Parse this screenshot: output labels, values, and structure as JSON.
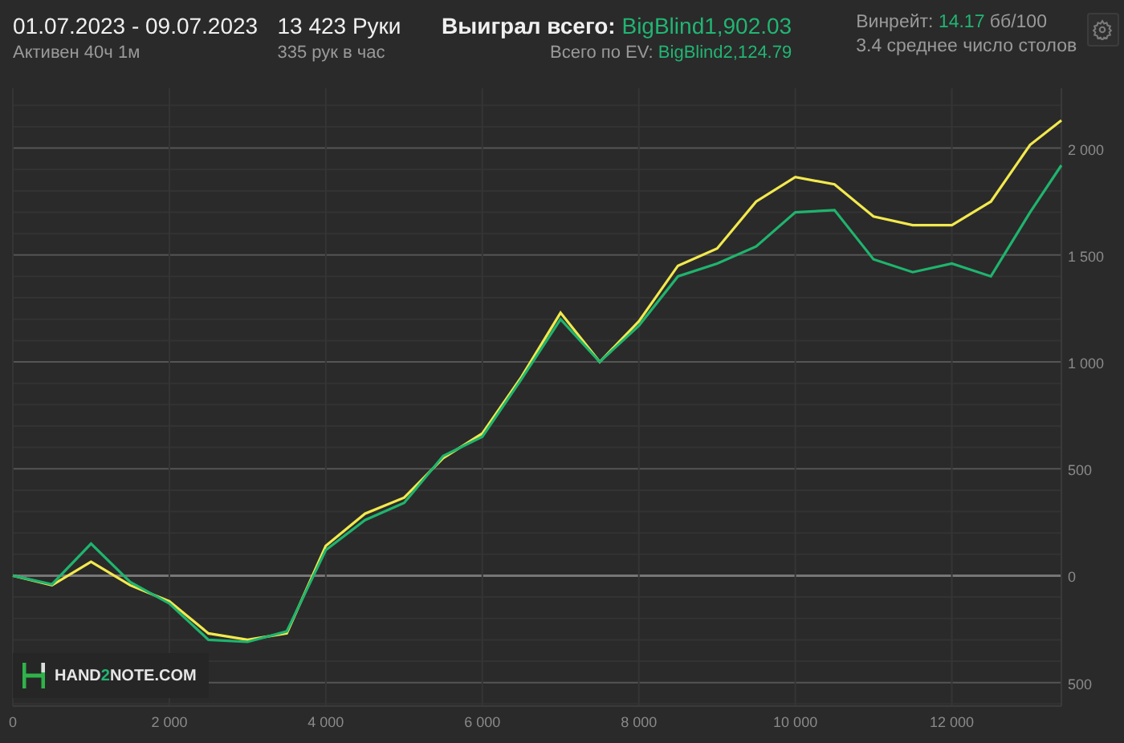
{
  "header": {
    "period": "01.07.2023 - 09.07.2023",
    "active": "Активен 40ч 1м",
    "hands": "13 423 Руки",
    "hands_rate": "335 рук в час",
    "won_label": "Выиграл всего:",
    "won_value": "BigBlind1,902.03",
    "ev_label": "Всего по EV:",
    "ev_value": "BigBlind2,124.79",
    "winrate_label": "Винрейт:",
    "winrate_value": "14.17",
    "winrate_unit": "бб/100",
    "tables": "3.4 среднее число столов"
  },
  "logo": {
    "before": "HAND",
    "accent": "2",
    "after": "NOTE.COM"
  },
  "chart_data": {
    "type": "line",
    "grid": true,
    "xlim": [
      0,
      13400
    ],
    "ylim": [
      -610,
      2280
    ],
    "xticks": [
      {
        "value": 0,
        "label": "0"
      },
      {
        "value": 2000,
        "label": "2 000"
      },
      {
        "value": 4000,
        "label": "4 000"
      },
      {
        "value": 6000,
        "label": "6 000"
      },
      {
        "value": 8000,
        "label": "8 000"
      },
      {
        "value": 10000,
        "label": "10 000"
      },
      {
        "value": 12000,
        "label": "12 000"
      }
    ],
    "yticks": [
      {
        "value": 2000,
        "label": "2 000"
      },
      {
        "value": 1500,
        "label": "1 500"
      },
      {
        "value": 1000,
        "label": "1 000"
      },
      {
        "value": 500,
        "label": "500"
      },
      {
        "value": 0,
        "label": "0"
      },
      {
        "value": -500,
        "label": "500"
      }
    ],
    "x": [
      0,
      500,
      1000,
      1500,
      2000,
      2500,
      3000,
      3500,
      4000,
      4500,
      5000,
      5500,
      6000,
      6500,
      7000,
      7500,
      8000,
      8500,
      9000,
      9500,
      10000,
      10500,
      11000,
      11500,
      12000,
      12500,
      13000,
      13400
    ],
    "series": [
      {
        "color": "#f2e94e",
        "values": [
          0,
          -45,
          65,
          -45,
          -120,
          -270,
          -300,
          -270,
          140,
          290,
          365,
          550,
          665,
          930,
          1230,
          1000,
          1190,
          1450,
          1530,
          1750,
          1865,
          1830,
          1680,
          1640,
          1640,
          1750,
          2015,
          2130
        ]
      },
      {
        "color": "#1fb46e",
        "values": [
          0,
          -40,
          150,
          -30,
          -130,
          -300,
          -310,
          -260,
          120,
          260,
          340,
          560,
          650,
          920,
          1200,
          1000,
          1170,
          1400,
          1460,
          1540,
          1700,
          1710,
          1480,
          1420,
          1460,
          1400,
          1700,
          1920
        ]
      }
    ]
  }
}
